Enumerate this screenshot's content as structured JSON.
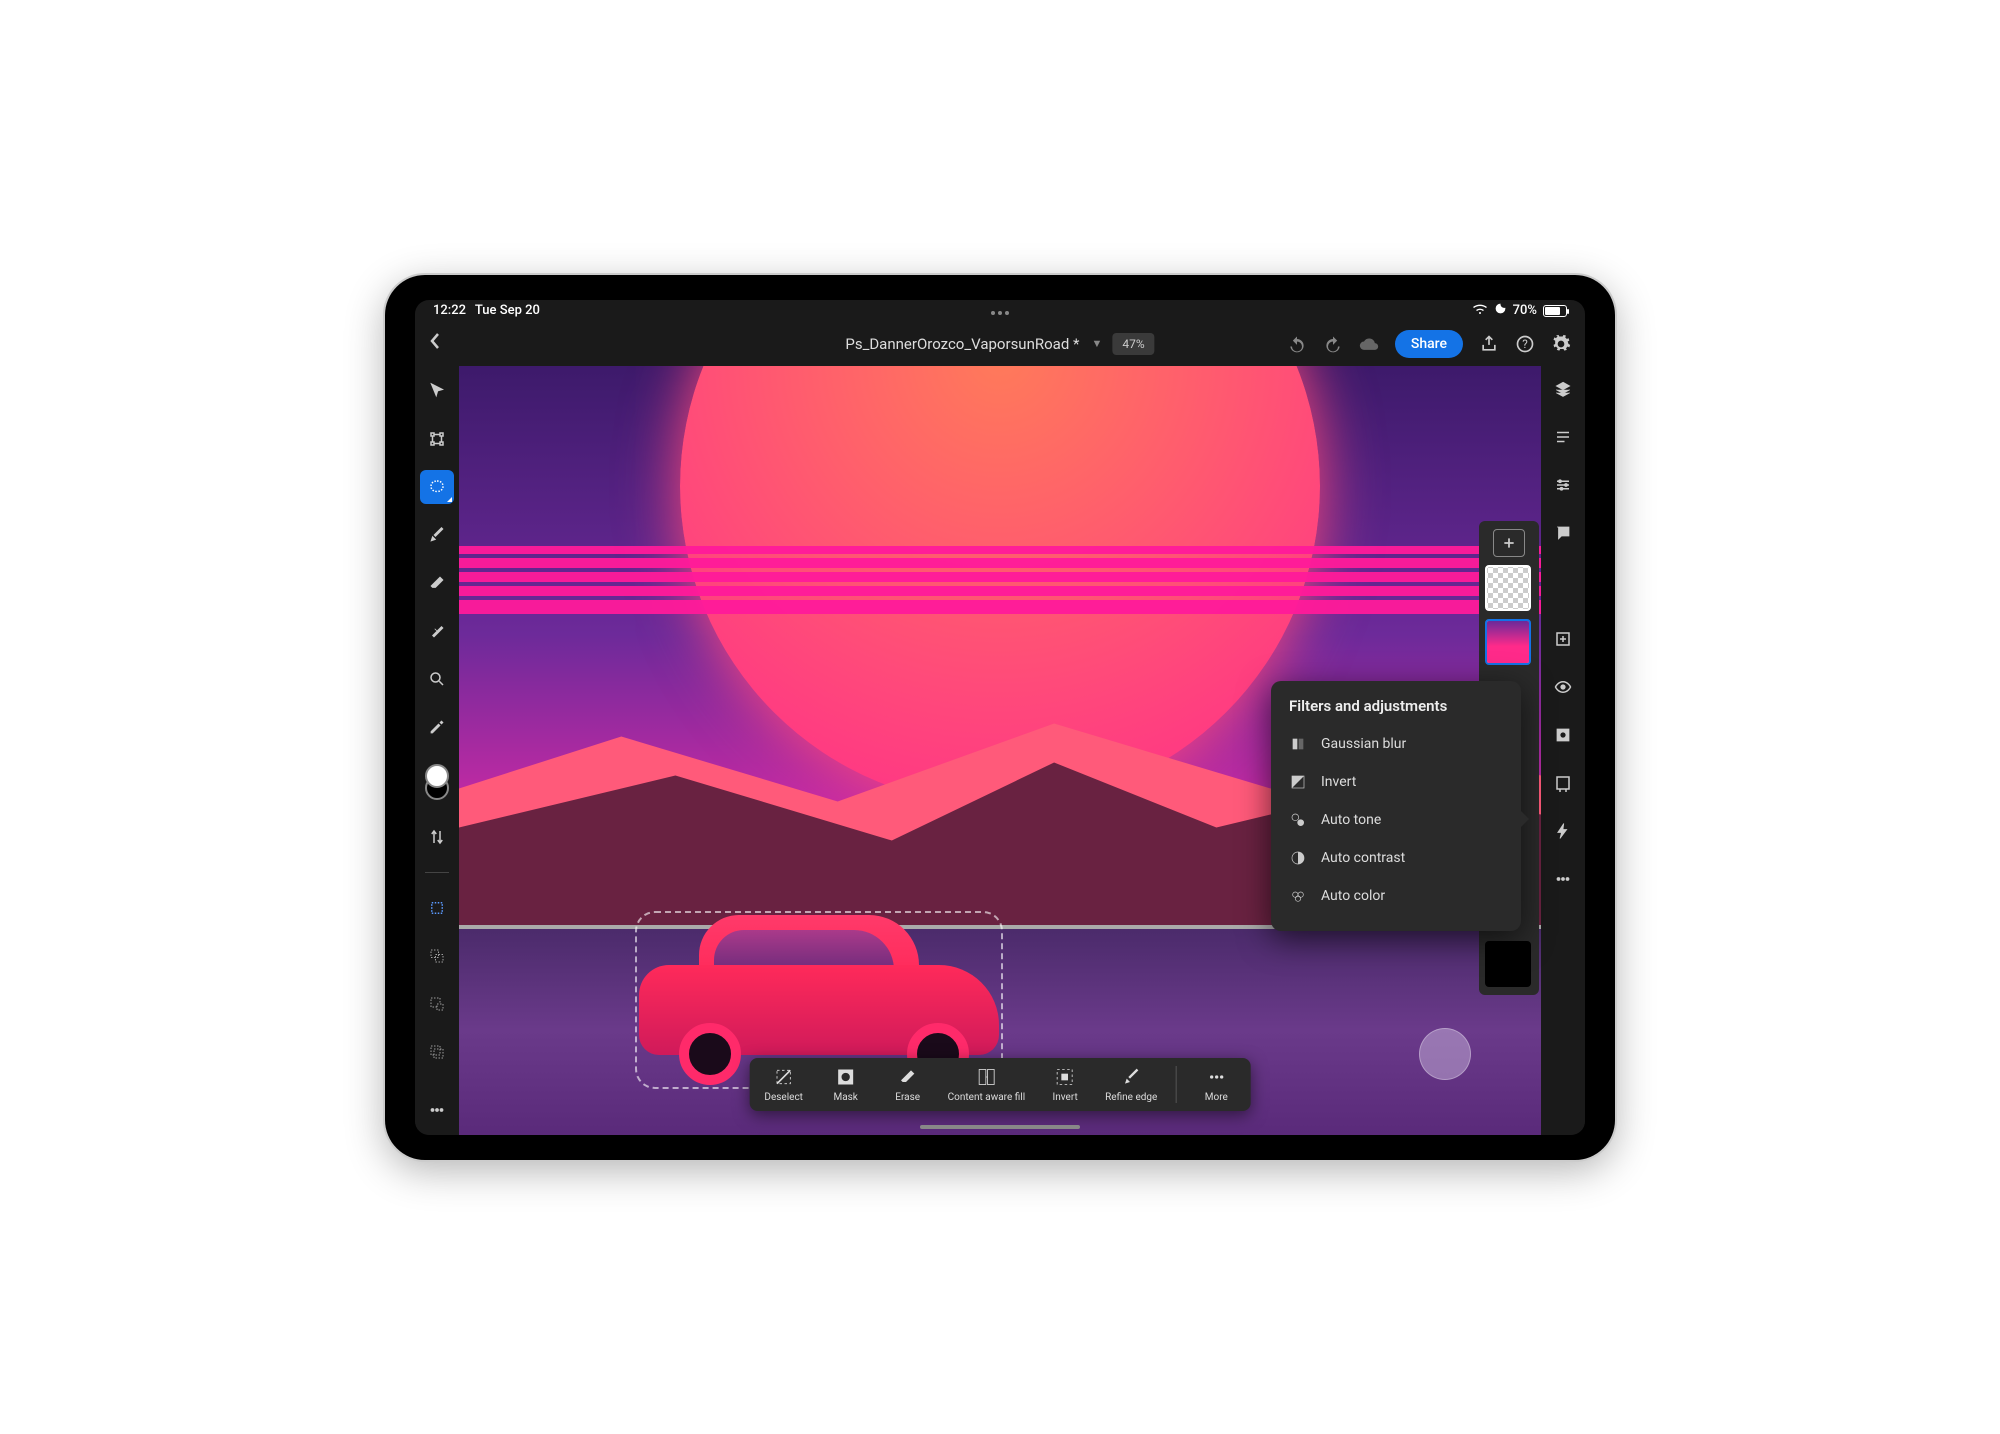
{
  "status": {
    "time": "12:22",
    "date": "Tue Sep 20",
    "battery_pct": "70%"
  },
  "header": {
    "doc_title": "Ps_DannerOrozco_VaporsunRoad *",
    "zoom": "47%",
    "share_label": "Share"
  },
  "left_tools": [
    {
      "name": "move",
      "selected": false
    },
    {
      "name": "transform",
      "selected": false
    },
    {
      "name": "lasso-select",
      "selected": true
    },
    {
      "name": "brush",
      "selected": false
    },
    {
      "name": "eraser",
      "selected": false
    },
    {
      "name": "healing-brush",
      "selected": false
    },
    {
      "name": "zoom",
      "selected": false
    },
    {
      "name": "eyedropper",
      "selected": false
    }
  ],
  "colors": {
    "foreground": "#ffffff",
    "background": "#000000"
  },
  "selection_tools_secondary": [
    {
      "name": "rectangle-select"
    },
    {
      "name": "marquee-add"
    },
    {
      "name": "marquee-subtract"
    },
    {
      "name": "marquee-intersect"
    }
  ],
  "context_toolbar": [
    {
      "label": "Deselect",
      "name": "deselect"
    },
    {
      "label": "Mask",
      "name": "mask"
    },
    {
      "label": "Erase",
      "name": "erase"
    },
    {
      "label": "Content aware fill",
      "name": "content-aware-fill"
    },
    {
      "label": "Invert",
      "name": "invert"
    },
    {
      "label": "Refine edge",
      "name": "refine-edge"
    },
    {
      "label": "More",
      "name": "more"
    }
  ],
  "filters_panel": {
    "title": "Filters and adjustments",
    "items": [
      {
        "label": "Gaussian blur",
        "name": "gaussian-blur"
      },
      {
        "label": "Invert",
        "name": "invert"
      },
      {
        "label": "Auto tone",
        "name": "auto-tone"
      },
      {
        "label": "Auto contrast",
        "name": "auto-contrast"
      },
      {
        "label": "Auto color",
        "name": "auto-color"
      }
    ]
  },
  "right_tools": [
    {
      "name": "layers"
    },
    {
      "name": "layer-properties"
    },
    {
      "name": "adjustments"
    },
    {
      "name": "comments"
    },
    {
      "name": "add-adjustment"
    },
    {
      "name": "visibility"
    },
    {
      "name": "mask"
    },
    {
      "name": "filters-flash"
    },
    {
      "name": "lightning"
    },
    {
      "name": "more"
    }
  ],
  "layers": [
    {
      "id": "layer-hidden",
      "state": "hidden-transparent"
    },
    {
      "id": "layer-artwork",
      "state": "active"
    },
    {
      "id": "layer-black",
      "state": "black"
    }
  ]
}
